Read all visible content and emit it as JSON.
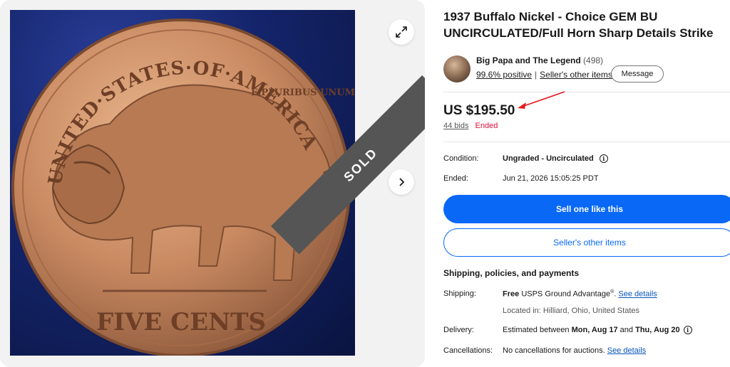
{
  "listing": {
    "title": "1937 Buffalo Nickel - Choice GEM BU UNCIRCULATED/Full Horn Sharp Details Strike",
    "sold_badge": "SOLD",
    "coin_top_text": "UNITED·STATES·OF·AMERICA",
    "coin_bottom_text": "FIVE CENTS",
    "coin_motto": "E PLURIBUS UNUM"
  },
  "seller": {
    "name": "Big Papa and The Legend",
    "feedback_count": "(498)",
    "positive": "99.6% positive",
    "other_items_link": "Seller's other items",
    "message_label": "Message"
  },
  "price": {
    "amount": "US $195.50",
    "bids": "44 bids",
    "status": "Ended"
  },
  "details": {
    "condition_label": "Condition:",
    "condition_value": "Ungraded - Uncirculated",
    "ended_label": "Ended:",
    "ended_value": "Jun 21, 2026 15:05:25 PDT"
  },
  "actions": {
    "sell_one_label": "Sell one like this",
    "seller_other_label": "Seller's other items"
  },
  "shipping": {
    "section_title": "Shipping, policies, and payments",
    "shipping_label": "Shipping:",
    "free": "Free",
    "method": "USPS Ground Advantage",
    "reg": "®",
    "dot": ".",
    "see_details": "See details",
    "location": "Located in: Hilliard, Ohio, United States",
    "delivery_label": "Delivery:",
    "delivery_prefix": "Estimated between",
    "delivery_start": "Mon, Aug 17",
    "delivery_and": "and",
    "delivery_end": "Thu, Aug 20",
    "cancellations_label": "Cancellations:",
    "cancellations_value": "No cancellations for auctions.",
    "cancellations_link": "See details"
  },
  "colors": {
    "primary_blue": "#0968f6",
    "ended_red": "#e0103a",
    "arrow_red": "#e8191c"
  },
  "icons": [
    "expand-icon",
    "chevron-right-icon",
    "info-icon"
  ]
}
